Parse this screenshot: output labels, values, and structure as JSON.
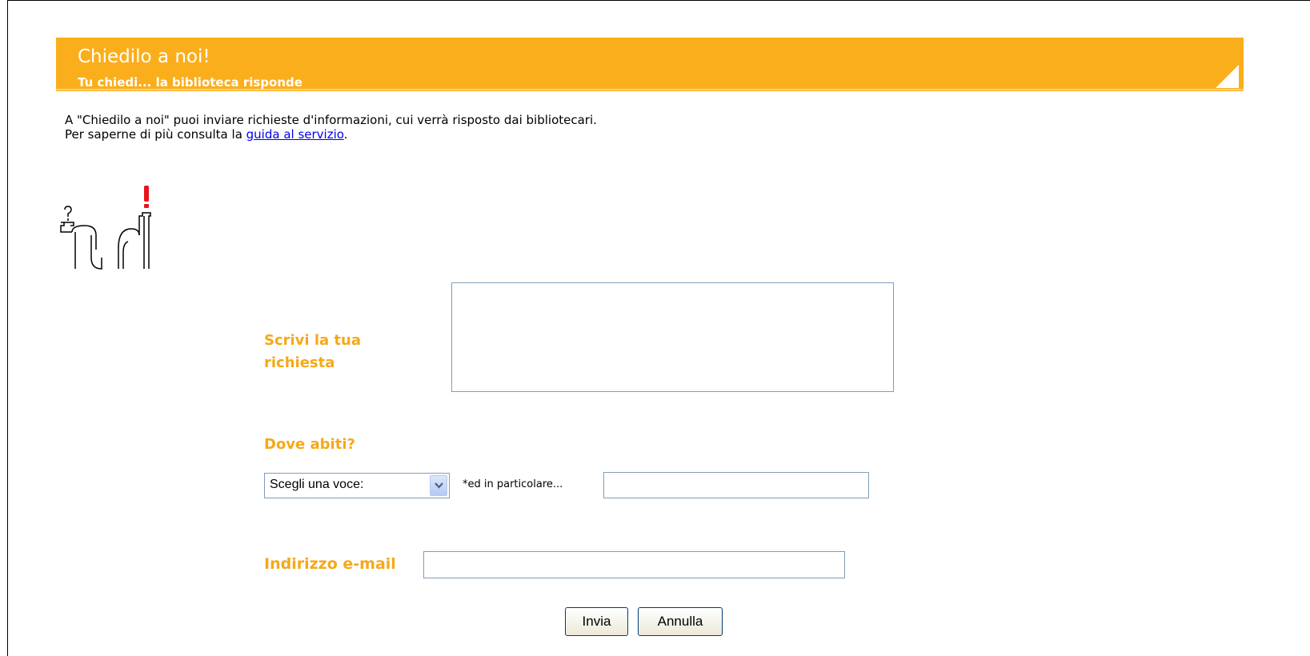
{
  "header": {
    "title": "Chiedilo a noi!",
    "subtitle": "Tu chiedi... la biblioteca risponde"
  },
  "intro": {
    "line1": "A \"Chiedilo a noi\" puoi inviare richieste d'informazioni, cui verrà risposto dai bibliotecari.",
    "line2_prefix": "Per saperne di più consulta la ",
    "guide_link": "guida al servizio",
    "line2_suffix": "."
  },
  "form": {
    "request_label": "Scrivi la tua richiesta",
    "request_value": "",
    "where_label": "Dove abiti?",
    "where_select_value": "Scegli una voce:",
    "particular_label": "*ed in particolare...",
    "particular_value": "",
    "email_label": "Indirizzo e-mail",
    "email_value": "",
    "submit_label": "Invia",
    "cancel_label": "Annulla"
  },
  "icons": {
    "logo": "people-question-answer-logo",
    "select_arrow": "chevron-down-icon",
    "corner": "corner-triangle-icon"
  },
  "colors": {
    "banner": "#fbae1c",
    "label": "#f6a818",
    "link": "#0000ee",
    "exclamation": "#e8141b"
  }
}
